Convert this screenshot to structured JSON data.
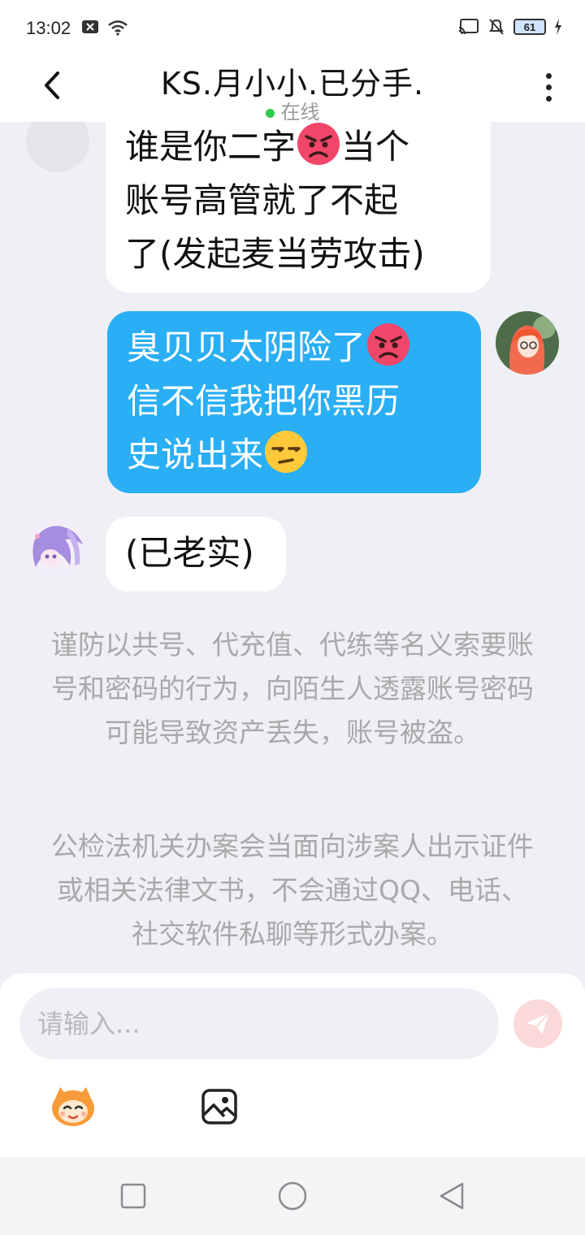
{
  "status_bar": {
    "time": "13:02",
    "battery": "61"
  },
  "header": {
    "title": "KS.月小小.已分手.",
    "online_status": "在线"
  },
  "messages": [
    {
      "side": "in",
      "lines": [
        "谁是你二字",
        "当个",
        "账号高管就了不起",
        "了(发起麦当劳攻击)"
      ]
    },
    {
      "side": "out",
      "lines": [
        "臭贝贝太阴险了",
        "信不信我把你黑历",
        "史说出来"
      ]
    },
    {
      "side": "in",
      "text": "(已老实)"
    }
  ],
  "notices": [
    "谨防以共号、代充值、代练等名义索要账号和密码的行为，向陌生人透露账号密码可能导致资产丢失，账号被盗。",
    "公检法机关办案会当面向涉案人出示证件或相关法律文书，不会通过QQ、电话、社交软件私聊等形式办案。"
  ],
  "input": {
    "placeholder": "请输入..."
  },
  "icons": {
    "back": "chevron-left-icon",
    "menu": "more-vertical-icon",
    "send": "paper-plane-icon",
    "emoji_tool": "mascot-icon",
    "image_tool": "image-icon"
  },
  "colors": {
    "out_bubble": "#2aaef4",
    "in_bubble": "#ffffff",
    "background": "#eef0f5",
    "online_dot": "#2ecc4a"
  }
}
